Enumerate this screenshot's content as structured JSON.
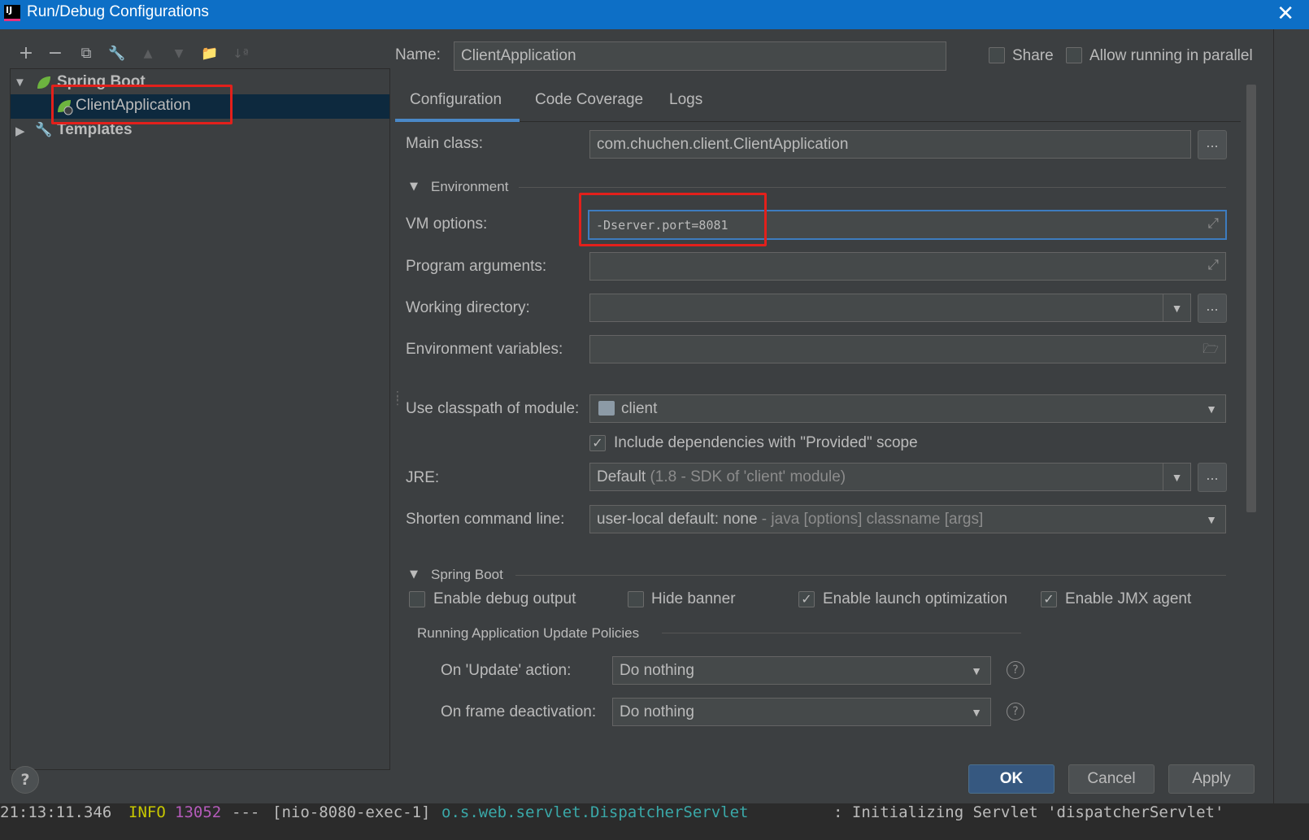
{
  "window": {
    "title": "Run/Debug Configurations",
    "app_icon_text": "IJ"
  },
  "toolbar": {
    "add": "+",
    "remove": "−",
    "copy": "⧉",
    "edit": "🔧",
    "up": "▲",
    "down": "▼",
    "folder": "📁",
    "sort": "↓ª"
  },
  "tree": {
    "spring_boot_label": "Spring Boot",
    "client_app_label": "ClientApplication",
    "templates_label": "Templates"
  },
  "header": {
    "name_label": "Name:",
    "name_value": "ClientApplication",
    "share_label": "Share",
    "allow_parallel_label": "Allow running in parallel"
  },
  "tabs": [
    {
      "label": "Configuration"
    },
    {
      "label": "Code Coverage"
    },
    {
      "label": "Logs"
    }
  ],
  "config": {
    "main_class_label": "Main class:",
    "main_class_value": "com.chuchen.client.ClientApplication",
    "environment_section": "Environment",
    "vm_options_label": "VM options:",
    "vm_options_value": "-Dserver.port=8081",
    "program_args_label": "Program arguments:",
    "program_args_value": "",
    "working_dir_label": "Working directory:",
    "working_dir_value": "",
    "env_vars_label": "Environment variables:",
    "env_vars_value": "",
    "classpath_label": "Use classpath of module:",
    "classpath_value": "client",
    "include_deps_label": "Include dependencies with \"Provided\" scope",
    "include_deps_checked": true,
    "jre_label": "JRE:",
    "jre_value": "Default",
    "jre_detail": "(1.8 - SDK of 'client' module)",
    "shorten_label": "Shorten command line:",
    "shorten_value": "user-local default: none",
    "shorten_detail": "- java [options] classname [args]",
    "dots": "..."
  },
  "spring_boot": {
    "section": "Spring Boot",
    "debug_output_label": "Enable debug output",
    "debug_output_checked": false,
    "hide_banner_label": "Hide banner",
    "hide_banner_checked": false,
    "launch_opt_label": "Enable launch optimization",
    "launch_opt_checked": true,
    "jmx_label": "Enable JMX agent",
    "jmx_checked": true,
    "policies_section": "Running Application Update Policies",
    "on_update_label": "On 'Update' action:",
    "on_update_value": "Do nothing",
    "on_frame_label": "On frame deactivation:",
    "on_frame_value": "Do nothing"
  },
  "buttons": {
    "ok": "OK",
    "cancel": "Cancel",
    "apply": "Apply",
    "help": "?"
  },
  "console": {
    "time": "21:13:11.346",
    "level": "INFO",
    "pid": "13052",
    "sep": "---",
    "thread": "[nio-8080-exec-1]",
    "logger": "o.s.web.servlet.DispatcherServlet",
    "message": ": Initializing Servlet 'dispatcherServlet'"
  },
  "colors": {
    "titlebar": "#0d6fc6",
    "background": "#3c3f41",
    "selection": "#0d293e",
    "highlight_box": "#e3201b",
    "ok_button": "#365880"
  }
}
